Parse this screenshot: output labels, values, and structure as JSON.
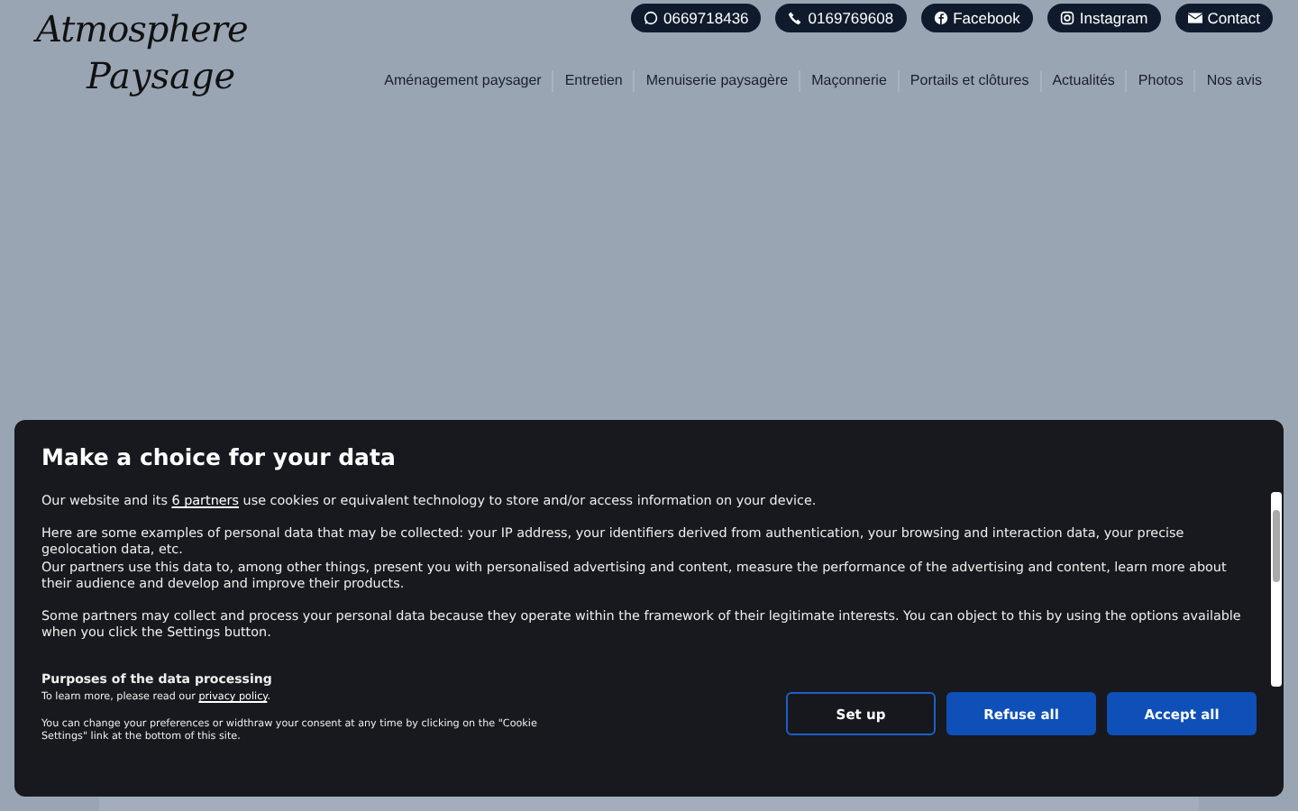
{
  "header": {
    "logo_line1": "Atmosphere",
    "logo_line2": "Paysage",
    "contacts": [
      {
        "kind": "whatsapp",
        "label": "0669718436"
      },
      {
        "kind": "phone",
        "label": "0169769608"
      },
      {
        "kind": "facebook",
        "label": "Facebook"
      },
      {
        "kind": "instagram",
        "label": "Instagram"
      },
      {
        "kind": "mail",
        "label": "Contact"
      }
    ],
    "nav": [
      "Aménagement paysager",
      "Entretien",
      "Menuiserie paysagère",
      "Maçonnerie",
      "Portails et clôtures",
      "Actualités",
      "Photos",
      "Nos avis"
    ]
  },
  "consent": {
    "title": "Make a choice for your data",
    "intro": {
      "before": "Our website and its ",
      "link": "6 partners",
      "after": " use cookies or equivalent technology to store and/or access information on your device."
    },
    "paragraphs": [
      "Here are some examples of personal data that may be collected: your IP address, your identifiers derived from authentication, your browsing and interaction data, your precise geolocation data, etc.\nOur partners use this data to, among other things, present you with personalised advertising and content, measure the performance of the advertising and content, learn more about their audience and develop and improve their products.",
      "Some partners may collect and process your personal data because they operate within the framework of their legitimate interests. You can object to this by using the options available when you click the Settings button."
    ],
    "purposes_title": "Purposes of the data processing",
    "learn_more": {
      "before": "To learn more, please read our ",
      "link": "privacy policy",
      "after": "."
    },
    "change_note": "You can change your preferences or widthraw your consent at any time by clicking on the \"Cookie Settings\" link at the bottom of this site.",
    "buttons": [
      {
        "kind": "outline",
        "label": "Set up"
      },
      {
        "kind": "primary",
        "label": "Refuse all"
      },
      {
        "kind": "primary",
        "label": "Accept all"
      }
    ]
  }
}
